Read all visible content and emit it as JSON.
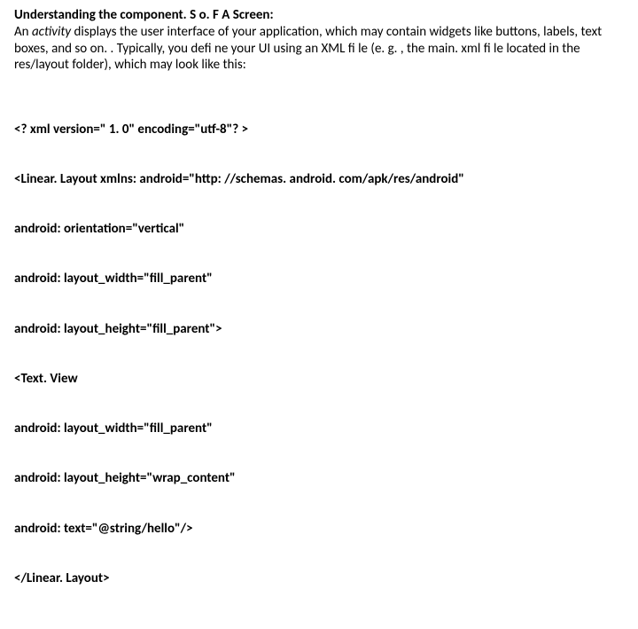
{
  "heading": "Understanding the component. S o. F A Screen:",
  "para_parts": {
    "p1a": "An ",
    "p1b": "activity",
    "p1c": " displays the user interface of your application, which may contain widgets like buttons, labels, text boxes, and so on. . Typically, you defi ne your UI using an XML fi le (e. g. , the main. xml fi le located in the res/layout folder), which may look like this:"
  },
  "code": [
    "<? xml version=\" 1. 0\" encoding=\"utf-8\"? >",
    "<Linear. Layout xmlns: android=\"http: //schemas. android. com/apk/res/android\"",
    "android: orientation=\"vertical\"",
    "android: layout_width=\"fill_parent\"",
    "android: layout_height=\"fill_parent\">",
    "<Text. View",
    "android: layout_width=\"fill_parent\"",
    "android: layout_height=\"wrap_content\"",
    "android: text=\"@string/hello\"/>",
    "</Linear. Layout>"
  ]
}
